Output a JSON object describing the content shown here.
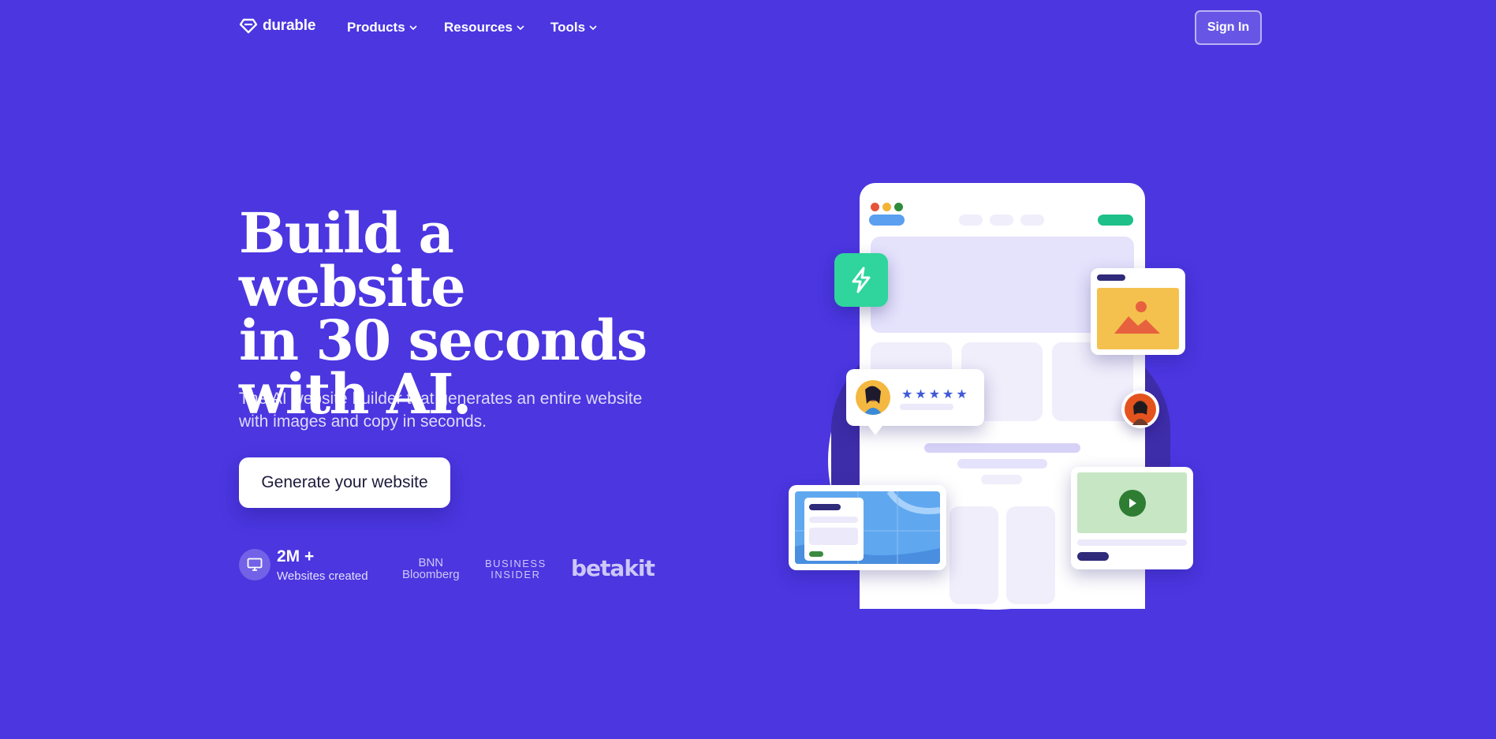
{
  "nav": {
    "logo_text": "durable",
    "links": [
      {
        "label": "Products"
      },
      {
        "label": "Resources"
      },
      {
        "label": "Tools"
      }
    ],
    "signin_label": "Sign In"
  },
  "hero": {
    "headline_line1": "Build a website",
    "headline_line2": "in 30 seconds",
    "headline_line3": "with AI.",
    "subhead_line1": "The AI website builder that generates an entire website",
    "subhead_line2": "with images and copy in seconds.",
    "cta_label": "Generate your website"
  },
  "stats": {
    "value": "2M +",
    "label": "Websites created"
  },
  "press": {
    "bnn_line1": "BNN",
    "bnn_line2": "Bloomberg",
    "bi_line1": "BUSINESS",
    "bi_line2": "INSIDER",
    "betakit": "betakit"
  },
  "review_card": {
    "stars": "★★★★★"
  },
  "colors": {
    "background": "#4b36e0",
    "accent_green": "#2fd59c",
    "image_card_yellow": "#f4c14e",
    "map_blue": "#5fa8f0",
    "video_green": "#c6e6c4"
  },
  "icons": [
    "diamond-logo-icon",
    "chevron-down-icon",
    "monitor-icon",
    "lightning-icon",
    "image-icon",
    "play-icon",
    "avatar"
  ]
}
